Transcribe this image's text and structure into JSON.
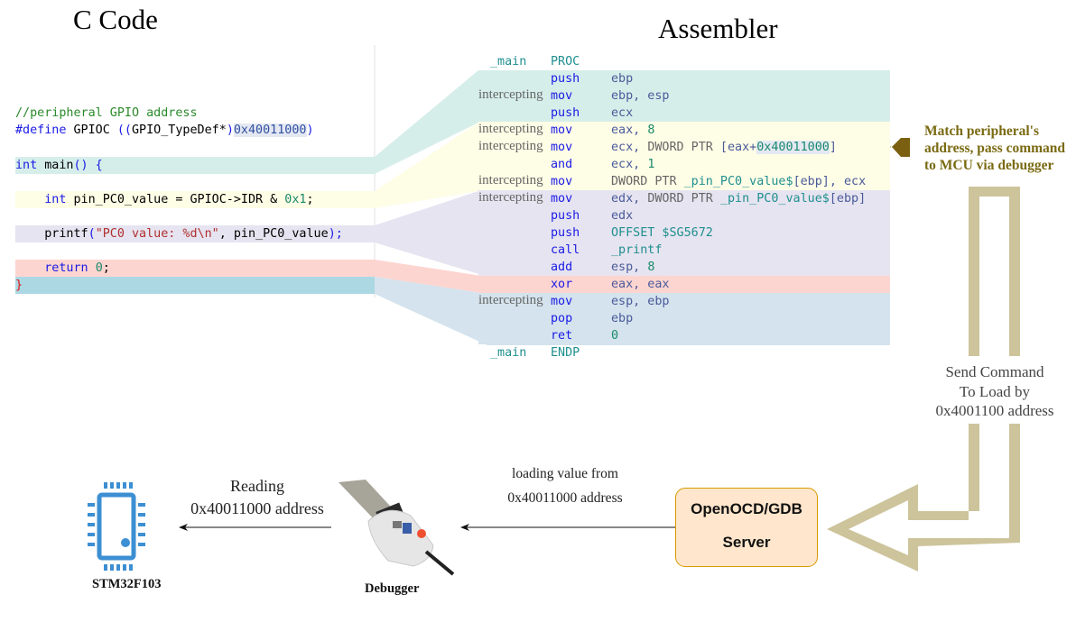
{
  "titles": {
    "c_code": "C Code",
    "assembler": "Assembler"
  },
  "colors": {
    "block_prologue": "#d6eee9",
    "block_read": "#fefde6",
    "block_printf": "#e6e4f0",
    "block_return": "#fdd5d0",
    "block_epilogue_c": "#acd8e4",
    "block_epilogue_asm": "#d4e3ed",
    "note_color": "#7a6a12",
    "flow_arrow": "#cdc49c",
    "server_fill": "#ffe6cc",
    "server_border": "#d79b00",
    "chip_blue": "#3c8fd3"
  },
  "c_code": {
    "comment": "//peripheral GPIO address",
    "define": {
      "keyword": "#define",
      "name": " GPIOC ",
      "open": "((",
      "type": "GPIO_TypeDef*",
      "close_type": ")",
      "address": "0x40011000",
      "close": ")"
    },
    "main_sig": {
      "type": "int",
      "name": " main",
      "parens": "() {"
    },
    "line_read": {
      "type": "int",
      "rest": " pin_PC0_value = GPIOC->IDR & ",
      "num": "0x1",
      "end": ";"
    },
    "line_printf": {
      "fn": "printf",
      "open": "(",
      "str": "\"PC0 value: %d\\n\"",
      "rest": ", pin_PC0_value",
      "close": ");"
    },
    "line_return": {
      "kw": "return",
      "num": "0",
      "end": ";"
    },
    "closing_brace": "}"
  },
  "assembler": {
    "intercept_label": "intercepting",
    "proc_label": "_main",
    "proc_kw": "PROC",
    "endp_kw": "ENDP",
    "lines": [
      {
        "intercept": false,
        "op": "push",
        "args": "ebp"
      },
      {
        "intercept": true,
        "op": "mov",
        "args": "ebp, esp"
      },
      {
        "intercept": false,
        "op": "push",
        "args": "ecx"
      },
      {
        "intercept": true,
        "op": "mov",
        "args": "eax, 8"
      },
      {
        "intercept": true,
        "op": "mov",
        "args": "ecx, DWORD PTR [eax+0x40011000]"
      },
      {
        "intercept": false,
        "op": "and",
        "args": "ecx, 1"
      },
      {
        "intercept": true,
        "op": "mov",
        "args": "DWORD PTR _pin_PC0_value$[ebp], ecx"
      },
      {
        "intercept": true,
        "op": "mov",
        "args": "edx, DWORD PTR _pin_PC0_value$[ebp]"
      },
      {
        "intercept": false,
        "op": "push",
        "args": "edx"
      },
      {
        "intercept": false,
        "op": "push",
        "args": "OFFSET $SG5672"
      },
      {
        "intercept": false,
        "op": "call",
        "args": "_printf"
      },
      {
        "intercept": false,
        "op": "add",
        "args": "esp, 8"
      },
      {
        "intercept": false,
        "op": "xor",
        "args": "eax, eax"
      },
      {
        "intercept": true,
        "op": "mov",
        "args": "esp, ebp"
      },
      {
        "intercept": false,
        "op": "pop",
        "args": "ebp"
      },
      {
        "intercept": false,
        "op": "ret",
        "args": "0"
      }
    ]
  },
  "annotation": {
    "lines": [
      "Match peripheral's",
      "address, pass command",
      "to MCU via debugger"
    ]
  },
  "send_command": {
    "lines": [
      "Send Command",
      "To Load by",
      "0x4001100 address"
    ]
  },
  "server": {
    "line1": "OpenOCD/GDB",
    "line2": "Server"
  },
  "loading_label": {
    "line1": "loading value from",
    "line2": "0x40011000 address"
  },
  "reading_label": {
    "line1": "Reading",
    "line2": "0x40011000 address"
  },
  "debugger": {
    "label": "Debugger"
  },
  "mcu": {
    "label": "STM32F103"
  }
}
